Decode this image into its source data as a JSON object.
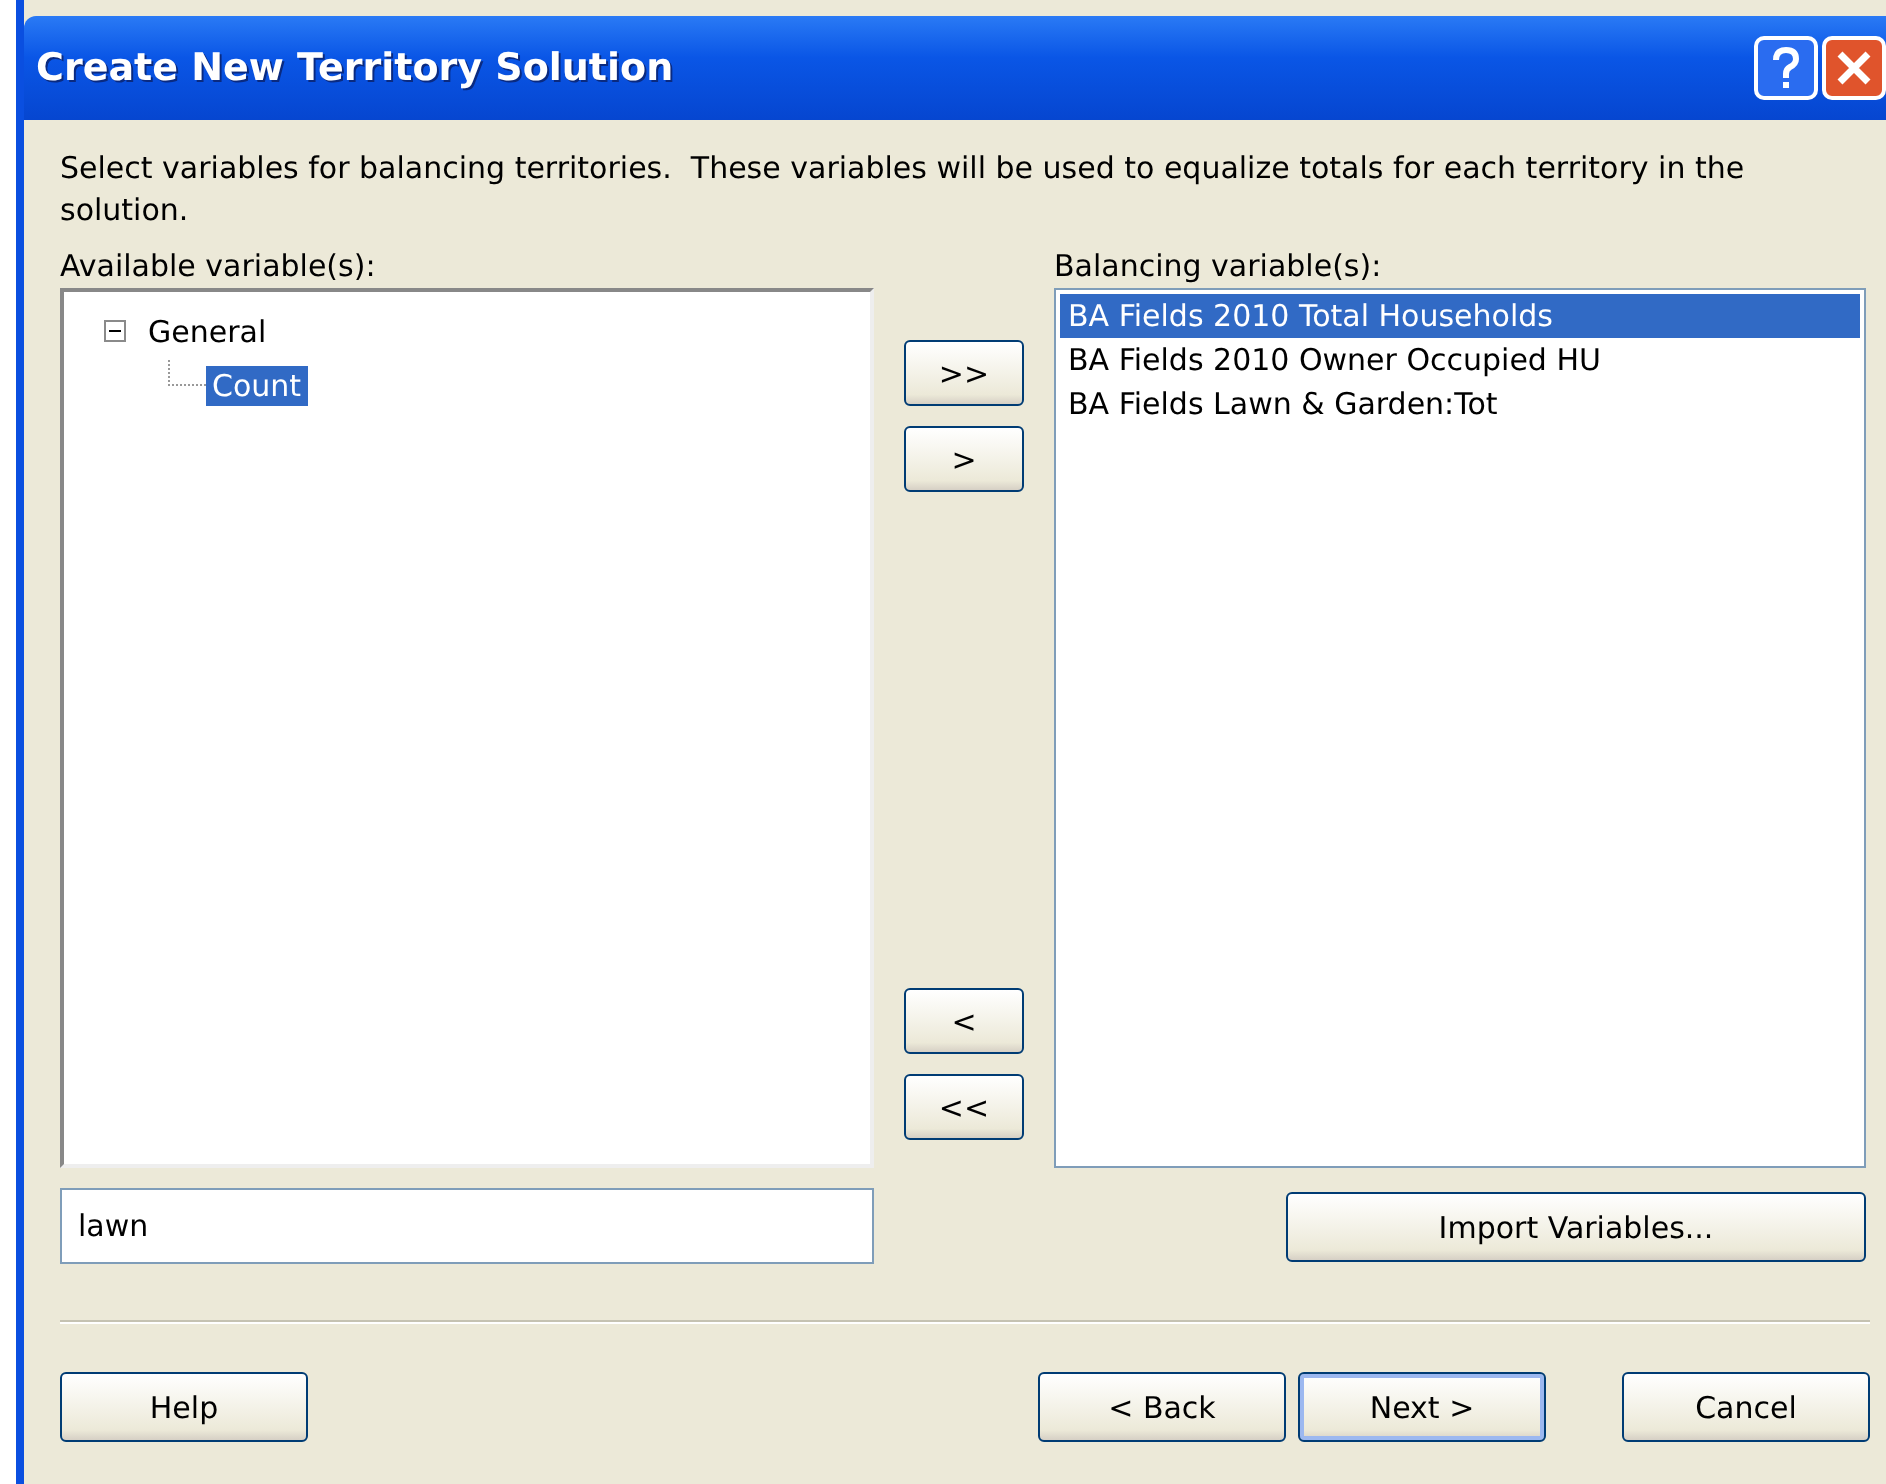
{
  "window": {
    "title": "Create New Territory Solution"
  },
  "description": "Select variables for balancing territories.  These variables will be used to equalize totals for each territory in the solution.",
  "available": {
    "label": "Available variable(s):",
    "tree": [
      {
        "label": "General",
        "expanded": true,
        "selected": false,
        "children": [
          {
            "label": "Count",
            "selected": true
          }
        ]
      }
    ],
    "filter": {
      "value": "lawn"
    }
  },
  "move_buttons_top": [
    ">>",
    ">"
  ],
  "move_buttons_bottom": [
    "<",
    "<<"
  ],
  "balancing": {
    "label": "Balancing variable(s):",
    "items": [
      {
        "label": "BA Fields 2010 Total Households",
        "selected": true
      },
      {
        "label": "BA Fields 2010 Owner Occupied HU",
        "selected": false
      },
      {
        "label": "BA Fields Lawn & Garden:Tot",
        "selected": false
      }
    ],
    "import_button": "Import Variables..."
  },
  "footer": {
    "help": "Help",
    "back": "< Back",
    "next": "Next >",
    "cancel": "Cancel"
  }
}
